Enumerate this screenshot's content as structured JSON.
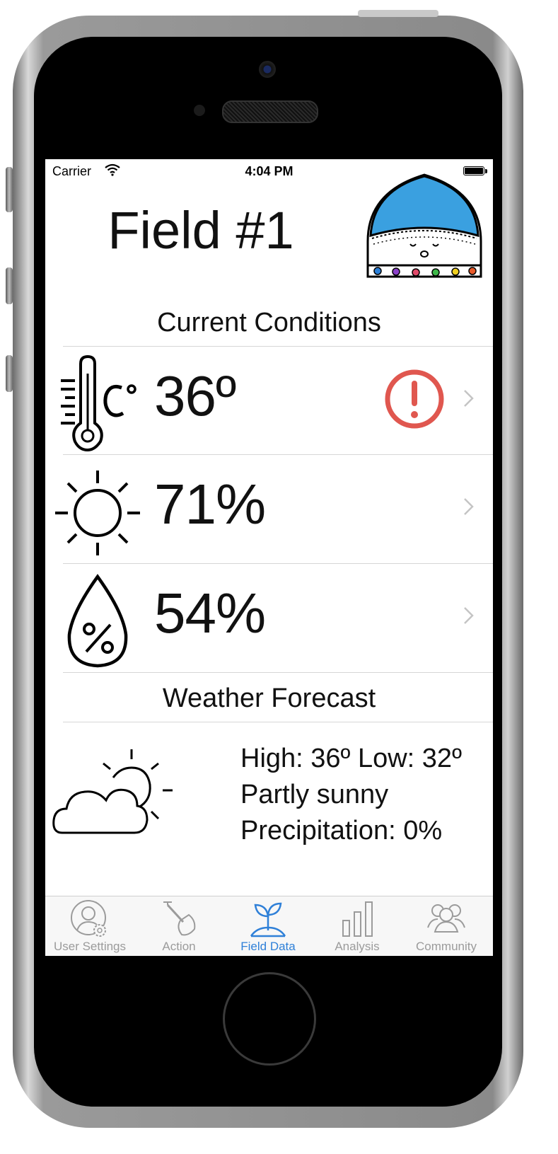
{
  "status_bar": {
    "carrier": "Carrier",
    "time": "4:04 PM"
  },
  "header": {
    "title": "Field #1"
  },
  "current_conditions": {
    "heading": "Current Conditions",
    "rows": [
      {
        "icon": "thermometer-celsius-icon",
        "value": "36º",
        "alert": true
      },
      {
        "icon": "sun-icon",
        "value": "71%",
        "alert": false
      },
      {
        "icon": "humidity-drop-icon",
        "value": "54%",
        "alert": false
      }
    ]
  },
  "weather_forecast": {
    "heading": "Weather Forecast",
    "icon": "partly-cloudy-icon",
    "lines": [
      "High: 36º Low: 32º",
      "Partly sunny",
      "Precipitation: 0%"
    ]
  },
  "tab_bar": {
    "tabs": [
      {
        "label": "User Settings",
        "icon": "user-settings-icon",
        "active": false
      },
      {
        "label": "Action",
        "icon": "shovel-icon",
        "active": false
      },
      {
        "label": "Field Data",
        "icon": "sprout-icon",
        "active": true
      },
      {
        "label": "Analysis",
        "icon": "bar-chart-icon",
        "active": false
      },
      {
        "label": "Community",
        "icon": "community-icon",
        "active": false
      }
    ]
  },
  "colors": {
    "accent": "#2f80d8",
    "alert": "#e0574f",
    "mascot_hat": "#3aa0e0"
  }
}
